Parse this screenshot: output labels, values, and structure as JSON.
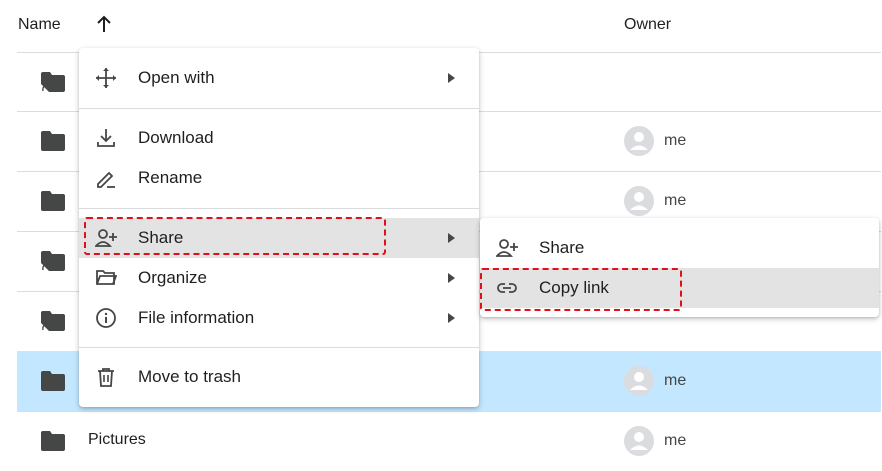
{
  "table": {
    "headers": {
      "name": "Name",
      "owner": "Owner"
    },
    "sort": {
      "direction": "ascending",
      "icon": "arrow-up-icon"
    },
    "rows": [
      {
        "name": "",
        "icon": "shared-folder-icon",
        "owner": "",
        "selected": false
      },
      {
        "name": "",
        "icon": "folder-icon",
        "owner": "me",
        "selected": false
      },
      {
        "name": "",
        "icon": "folder-icon",
        "owner": "me",
        "selected": false
      },
      {
        "name": "",
        "icon": "shared-folder-icon",
        "owner": "",
        "selected": false
      },
      {
        "name": "",
        "icon": "shared-folder-icon",
        "owner": "",
        "selected": false
      },
      {
        "name": "",
        "icon": "folder-icon",
        "owner": "me",
        "selected": true
      },
      {
        "name": "Pictures",
        "icon": "folder-icon",
        "owner": "me",
        "selected": false
      }
    ]
  },
  "context_menu": {
    "items": [
      {
        "label": "Open with",
        "icon": "move-arrows-icon",
        "submenu": true
      },
      {
        "label": "Download",
        "icon": "download-icon",
        "submenu": false
      },
      {
        "label": "Rename",
        "icon": "pencil-icon",
        "submenu": false
      },
      {
        "label": "Share",
        "icon": "add-person-icon",
        "submenu": true,
        "hovered": true
      },
      {
        "label": "Organize",
        "icon": "folder-open-icon",
        "submenu": true
      },
      {
        "label": "File information",
        "icon": "info-icon",
        "submenu": true
      },
      {
        "label": "Move to trash",
        "icon": "trash-icon",
        "submenu": false
      }
    ]
  },
  "share_submenu": {
    "items": [
      {
        "label": "Share",
        "icon": "add-person-icon"
      },
      {
        "label": "Copy link",
        "icon": "link-icon",
        "hovered": true
      }
    ]
  },
  "colors": {
    "selected_row": "#c2e7ff",
    "menu_hover": "#e3e3e3",
    "annotation_dash": "#e0101a",
    "icon": "#444746"
  }
}
